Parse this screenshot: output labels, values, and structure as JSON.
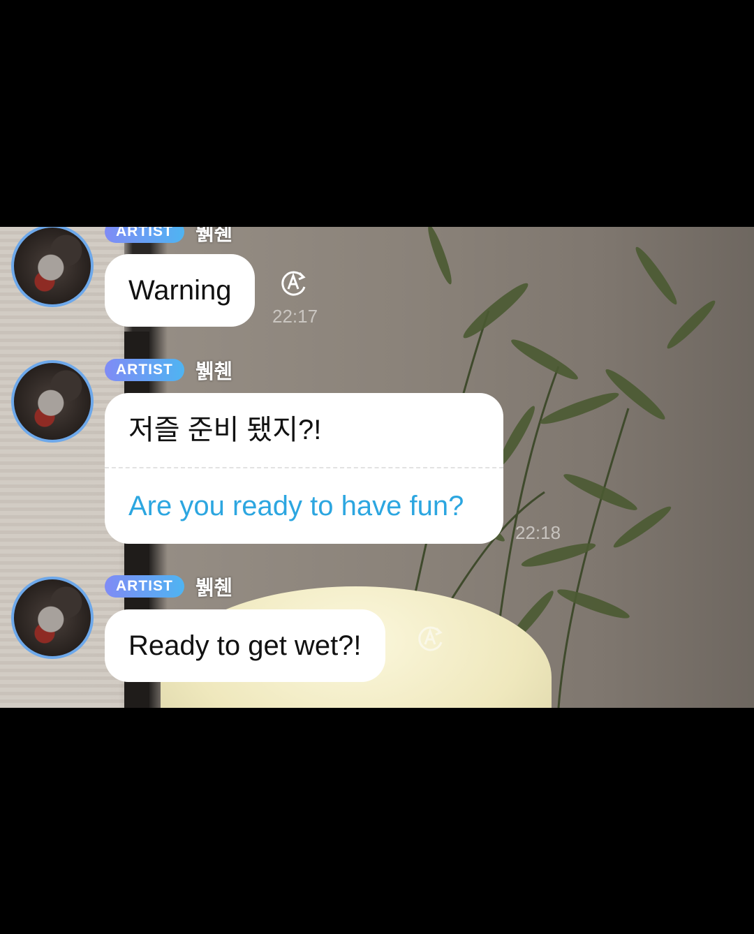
{
  "messages": [
    {
      "badge": "ARTIST",
      "sender": "뷁췐",
      "text": "Warning",
      "time": "22:17",
      "translate_icon": "translate-icon"
    },
    {
      "badge": "ARTIST",
      "sender": "뷁췐",
      "text": "저즐 준비 됐지?!",
      "translation": "Are you ready to have fun?",
      "time": "22:18"
    },
    {
      "badge": "ARTIST",
      "sender": "뷁췐",
      "text": "Ready to get wet?!",
      "translate_icon": "translate-icon"
    }
  ],
  "colors": {
    "badge_gradient_start": "#7f8bf5",
    "badge_gradient_end": "#4fb4f2",
    "translation_text": "#2ca6e0",
    "avatar_ring": "#6da8ea",
    "bubble": "#ffffff",
    "letterbox": "#000000"
  }
}
